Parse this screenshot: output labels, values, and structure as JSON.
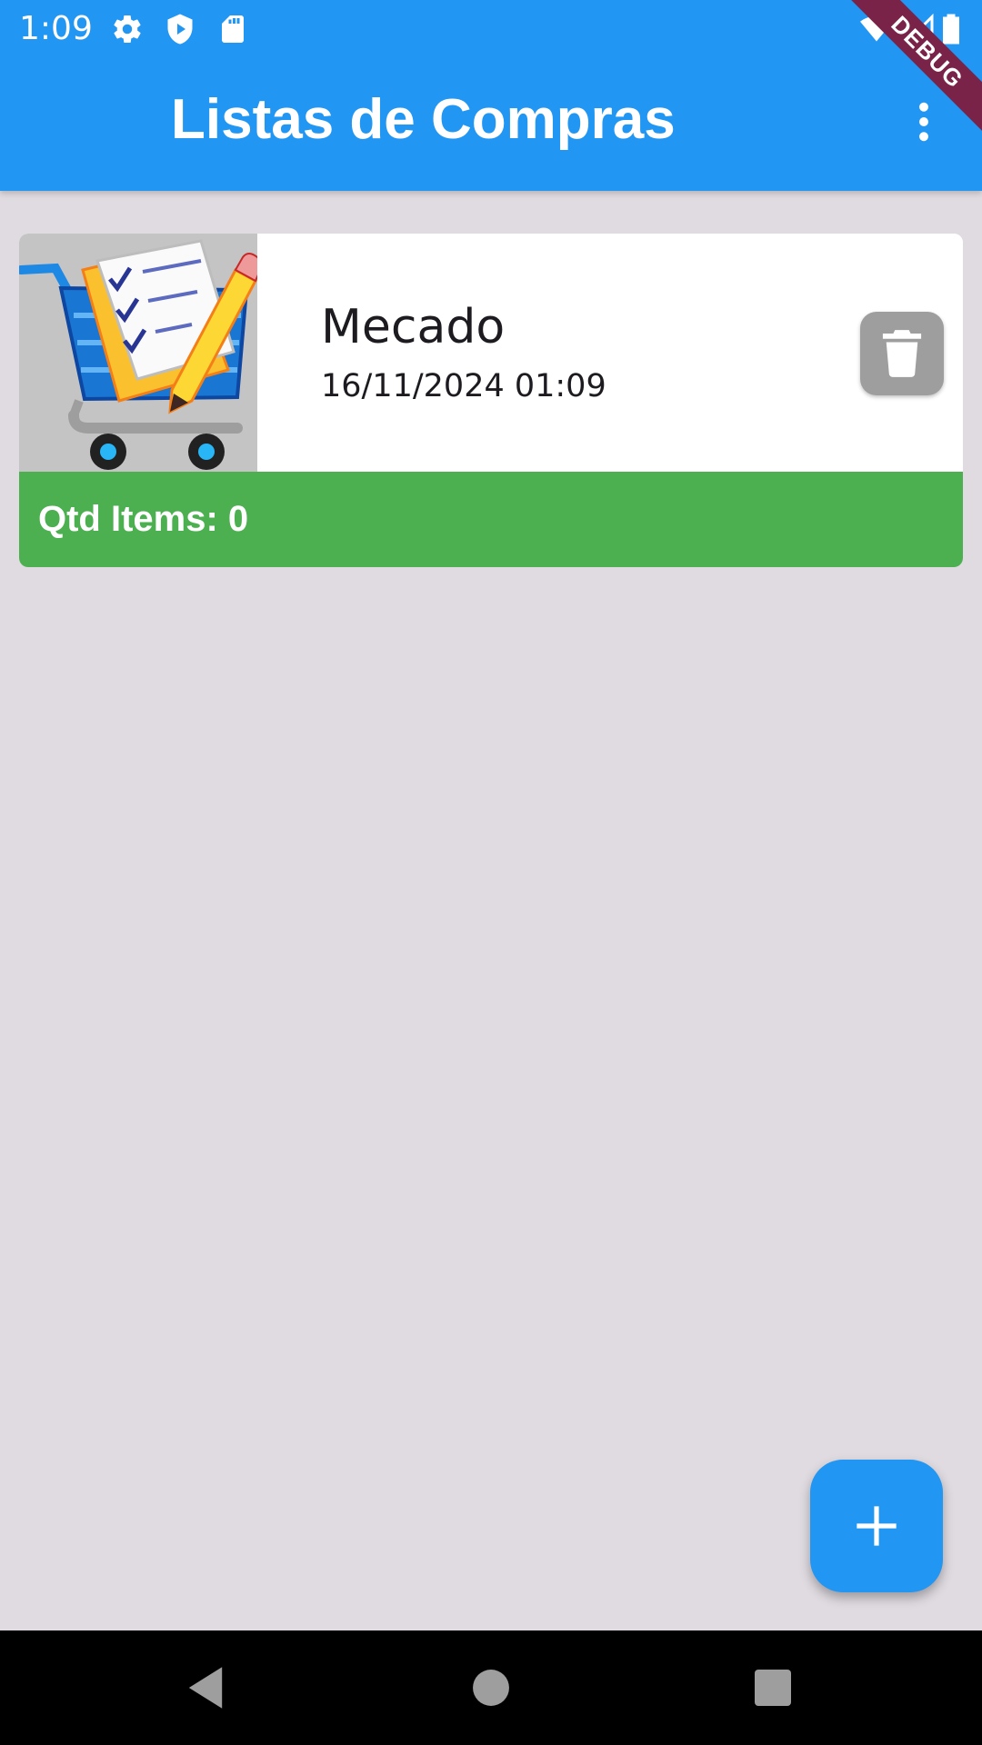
{
  "status_bar": {
    "time": "1:09",
    "icons": [
      "settings-icon",
      "shield-icon",
      "sd-card-icon",
      "wifi-icon",
      "signal-icon",
      "battery-icon"
    ]
  },
  "app_bar": {
    "title": "Listas de Compras",
    "menu_icon": "more-vert-icon",
    "debug_banner": "DEBUG"
  },
  "lists": [
    {
      "name": "Mecado",
      "date": "16/11/2024 01:09",
      "count_label": "Qtd Items: 0",
      "image_icon": "shopping-cart-checklist-image",
      "delete_icon": "trash-icon"
    }
  ],
  "fab": {
    "icon": "add-icon"
  },
  "nav_bar": {
    "icons": [
      "back-icon",
      "home-icon",
      "recents-icon"
    ]
  },
  "colors": {
    "primary": "#2196f3",
    "background": "#dfdbe1",
    "footer_green": "#4caf50",
    "delete_grey": "#9e9e9e",
    "debug_ribbon": "#7a2348"
  }
}
